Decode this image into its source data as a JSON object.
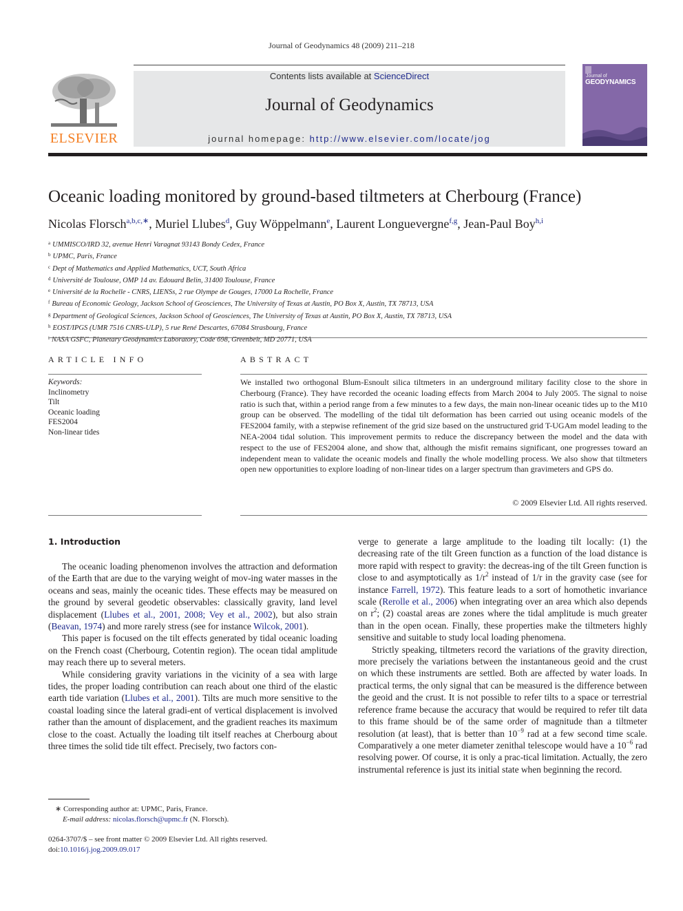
{
  "header": {
    "journal_ref": "Journal of Geodynamics 48 (2009) 211–218",
    "contents_prefix": "Contents lists available at ",
    "contents_link": "ScienceDirect",
    "journal_title": "Journal of Geodynamics",
    "homepage_prefix": "journal homepage: ",
    "homepage_url": "http://www.elsevier.com/locate/jog",
    "publisher_logo": "ELSEVIER",
    "cover": {
      "small": "Journal of",
      "title": "GEODYNAMICS"
    }
  },
  "article": {
    "title": "Oceanic loading monitored by ground-based tiltmeters at Cherbourg (France)",
    "authors": [
      {
        "name": "Nicolas Florsch",
        "sup": "a,b,c,∗",
        "sep": ", "
      },
      {
        "name": "Muriel Llubes",
        "sup": "d",
        "sep": ", "
      },
      {
        "name": "Guy Wöppelmann",
        "sup": "e",
        "sep": ", "
      },
      {
        "name": "Laurent Longuevergne",
        "sup": "f,g",
        "sep": ", "
      },
      {
        "name": "Jean-Paul Boy",
        "sup": "h,i",
        "sep": ""
      }
    ],
    "affiliations": [
      {
        "key": "a",
        "text": "UMMISCO/IRD 32, avenue Henri Varagnat 93143 Bondy Cedex, France"
      },
      {
        "key": "b",
        "text": "UPMC, Paris, France"
      },
      {
        "key": "c",
        "text": "Dept of Mathematics and Applied Mathematics, UCT, South Africa"
      },
      {
        "key": "d",
        "text": "Université de Toulouse, OMP 14 av. Edouard Belin, 31400 Toulouse, France"
      },
      {
        "key": "e",
        "text": "Université de la Rochelle - CNRS, LIENSs, 2 rue Olympe de Gouges, 17000 La Rochelle, France"
      },
      {
        "key": "f",
        "text": "Bureau of Economic Geology, Jackson School of Geosciences, The University of Texas at Austin, PO Box X, Austin, TX 78713, USA"
      },
      {
        "key": "g",
        "text": "Department of Geological Sciences, Jackson School of Geosciences, The University of Texas at Austin, PO Box X, Austin, TX 78713, USA"
      },
      {
        "key": "h",
        "text": "EOST/IPGS (UMR 7516 CNRS-ULP), 5 rue René Descartes, 67084 Strasbourg, France"
      },
      {
        "key": "i",
        "text": "NASA GSFC, Planetary Geodynamics Laboratory, Code 698, Greenbelt, MD 20771, USA"
      }
    ]
  },
  "article_info": {
    "heading": "ARTICLE INFO",
    "keywords_label": "Keywords:",
    "keywords": [
      "Inclinometry",
      "Tilt",
      "Oceanic loading",
      "FES2004",
      "Non-linear tides"
    ]
  },
  "abstract": {
    "heading": "ABSTRACT",
    "text": "We installed two orthogonal Blum-Esnoult silica tiltmeters in an underground military facility close to the shore in Cherbourg (France). They have recorded the oceanic loading effects from March 2004 to July 2005. The signal to noise ratio is such that, within a period range from a few minutes to a few days, the main non-linear oceanic tides up to the M10 group can be observed. The modelling of the tidal tilt deformation has been carried out using oceanic models of the FES2004 family, with a stepwise refinement of the grid size based on the unstructured grid T-UGAm model leading to the NEA-2004 tidal solution. This improvement permits to reduce the discrepancy between the model and the data with respect to the use of FES2004 alone, and show that, although the misfit remains significant, one progresses toward an independent mean to validate the oceanic models and finally the whole modelling process. We also show that tiltmeters open new opportunities to explore loading of non-linear tides on a larger spectrum than gravimeters and GPS do.",
    "copyright": "© 2009 Elsevier Ltd. All rights reserved."
  },
  "body": {
    "section_heading": "1.  Introduction",
    "p1": {
      "t1": "The oceanic loading phenomenon involves the attraction and deformation of the Earth that are due to the varying weight of mov-ing water masses in the oceans and seas, mainly the oceanic tides. These effects may be measured on the ground by several geodetic observables: classically gravity, land level displacement (",
      "c1": "Llubes et al., 2001, 2008; Vey et al., 2002",
      "t2": "), but also strain (",
      "c2": "Beavan, 1974",
      "t3": ") and more rarely stress (see for instance ",
      "c3": "Wilcok, 2001",
      "t4": ")."
    },
    "p2": "This paper is focused on the tilt effects generated by tidal oceanic loading on the French coast (Cherbourg, Cotentin region). The ocean tidal amplitude may reach there up to several meters.",
    "p3": {
      "t1": "While considering gravity variations in the vicinity of a sea with large tides, the proper loading contribution can reach about one third of the elastic earth tide variation (",
      "c1": "Llubes et al., 2001",
      "t2": "). Tilts are much more sensitive to the coastal loading since the lateral gradi-ent of vertical displacement is involved rather than the amount of displacement, and the gradient reaches its maximum close to the coast. Actually the loading tilt itself reaches at Cherbourg about three times the solid tide tilt effect. Precisely, two factors con-"
    },
    "p4": {
      "t1": "verge to generate a large amplitude to the loading tilt locally: (1) the decreasing rate of the tilt Green function as a function of the load distance is more rapid with respect to gravity: the decreas-ing of the tilt Green function is close to and asymptotically as 1/r",
      "sup1": "2",
      "t2": " instead of 1/r in the gravity case (see for instance ",
      "c1": "Farrell, 1972",
      "t3": "). This feature leads to a sort of homothetic invariance scale (",
      "c2": "Rerolle et al., 2006",
      "t4": ") when integrating over an area which also depends on r",
      "sup2": "2",
      "t5": "; (2) coastal areas are zones where the tidal amplitude is much greater than in the open ocean. Finally, these properties make the tiltmeters highly sensitive and suitable to study local loading phenomena."
    },
    "p5": {
      "t1": "Strictly speaking, tiltmeters record the variations of the gravity direction, more precisely the variations between the instantaneous geoid and the crust on which these instruments are settled. Both are affected by water loads. In practical terms, the only signal that can be measured is the difference between the geoid and the crust. It is not possible to refer tilts to a space or terrestrial reference frame because the accuracy that would be required to refer tilt data to this frame should be of the same order of magnitude than a tiltmeter resolution (at least), that is better than 10",
      "sup1": "−9",
      "t2": " rad at a few second time scale. Comparatively a one meter diameter zenithal telescope would have a 10",
      "sup2": "−6",
      "t3": " rad resolving power. Of course, it is only a prac-tical limitation. Actually, the zero instrumental reference is just its initial state when beginning the record."
    }
  },
  "footnote": {
    "marker": "∗",
    "corresponding": "Corresponding author at: UPMC, Paris, France.",
    "email_label": "E-mail address:",
    "email": "nicolas.florsch@upmc.fr",
    "email_suffix": " (N. Florsch)."
  },
  "front_matter": {
    "issn_line": "0264-3707/$ – see front matter © 2009 Elsevier Ltd. All rights reserved.",
    "doi_prefix": "doi:",
    "doi": "10.1016/j.jog.2009.09.017"
  },
  "colors": {
    "link": "#1f2a8c",
    "elsevier_orange": "#f47d20",
    "masthead_gray": "#e6e7e8",
    "cover_purple": "#8468a8"
  }
}
